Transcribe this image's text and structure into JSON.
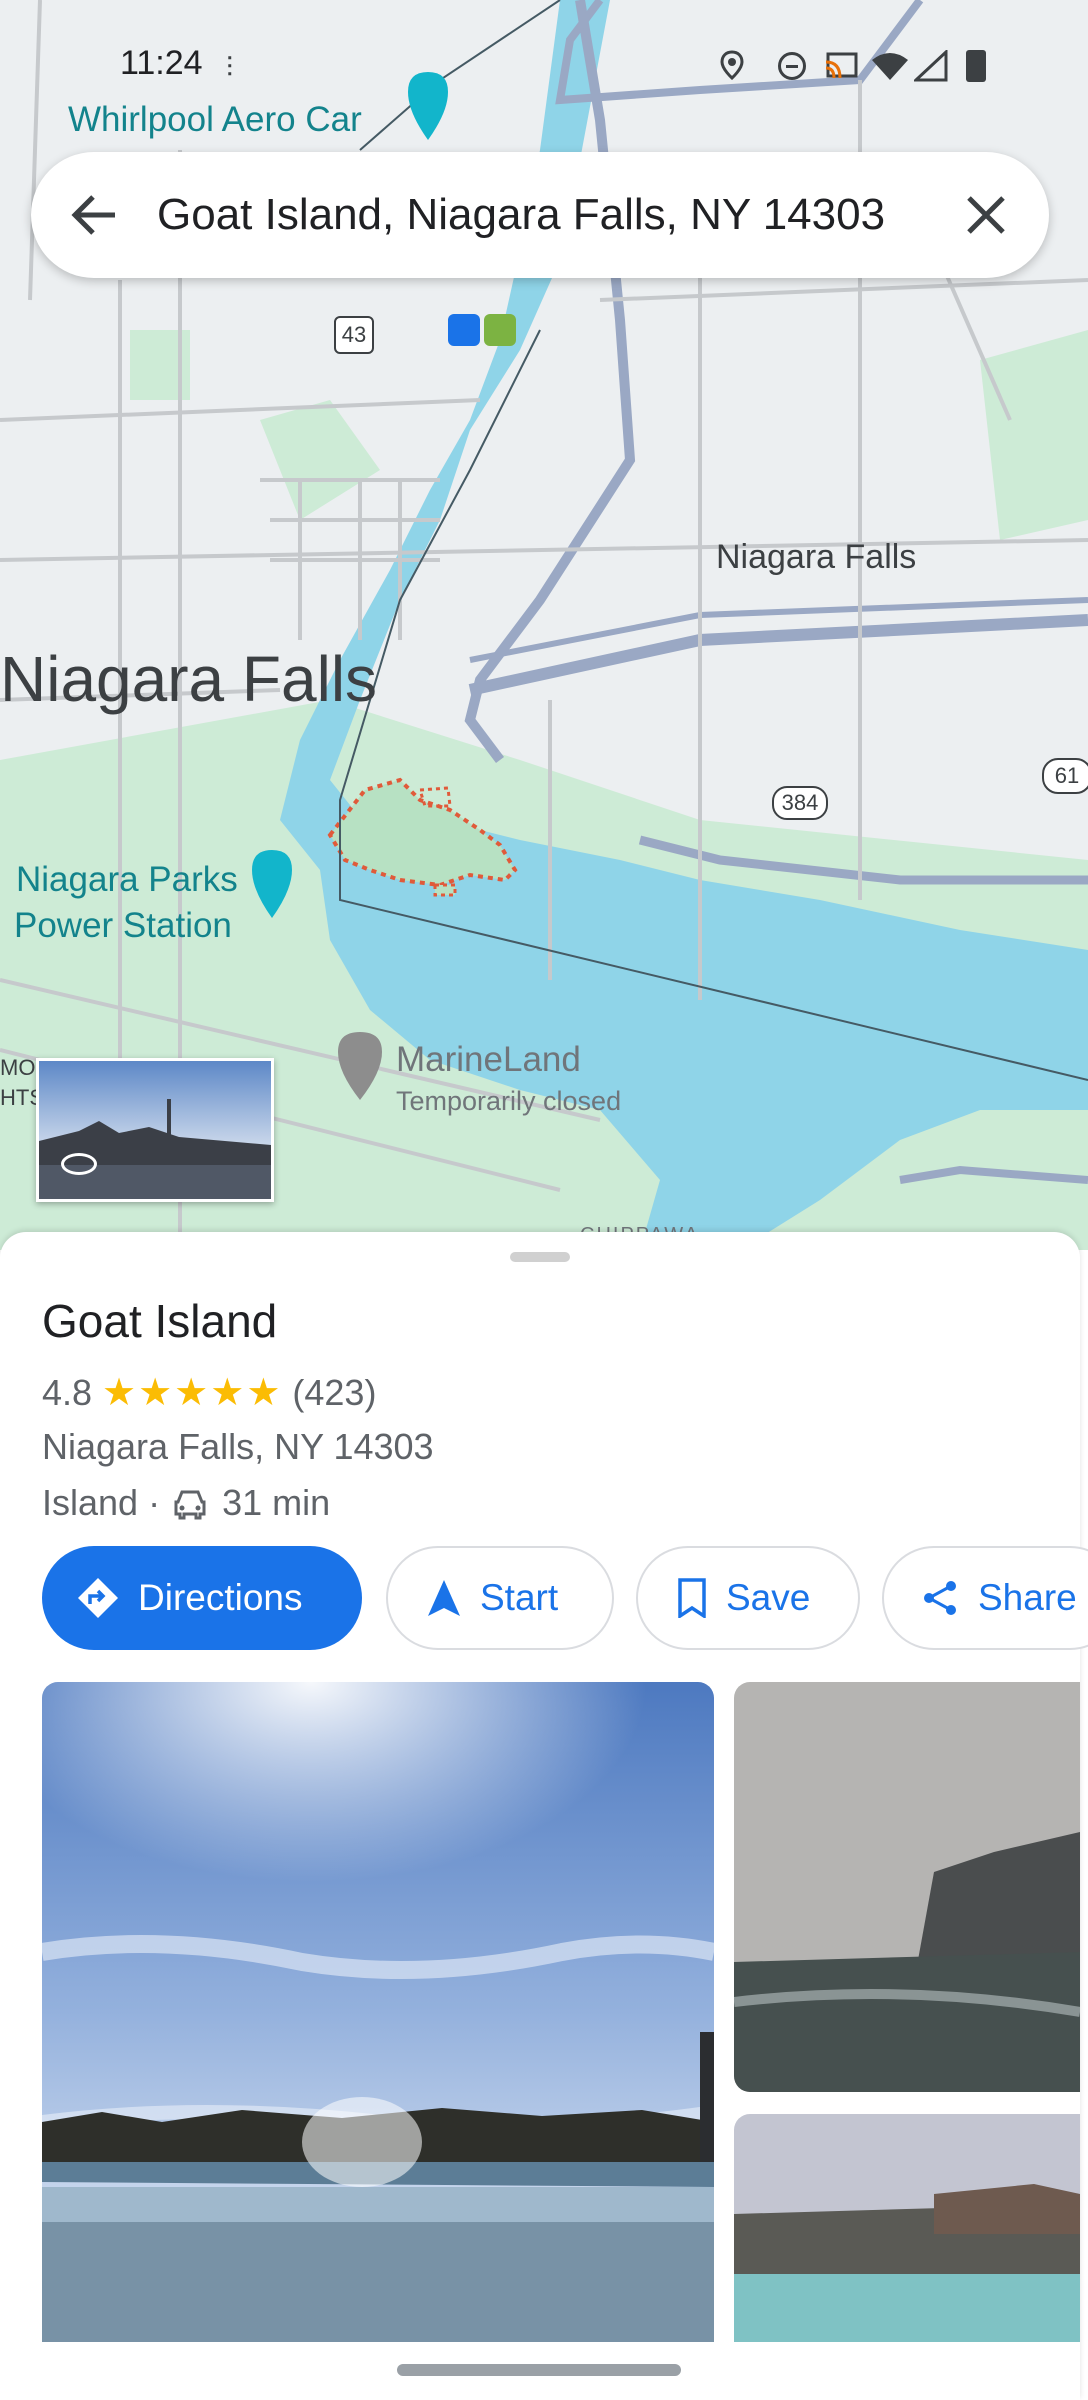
{
  "status": {
    "time": "11:24"
  },
  "search": {
    "query": "Goat Island, Niagara Falls, NY 14303"
  },
  "map": {
    "labels": {
      "whirlpool": "Whirlpool Aero Car",
      "niagara_falls_large": "Niagara Falls",
      "niagara_falls_small": "Niagara Falls",
      "parks_power_line1": "Niagara Parks",
      "parks_power_line2": "Power Station",
      "marineland": "MarineLand",
      "marineland_status": "Temporarily closed",
      "route_43": "43",
      "route_384": "384",
      "route_61": "61",
      "edge_label_1": "MON",
      "edge_label_2": "HTS",
      "chippawa": "CHIPPAWA"
    },
    "colors": {
      "water": "#8fd4e8",
      "park": "#cdebd6",
      "road": "#9aa8c4"
    }
  },
  "place": {
    "name": "Goat Island",
    "rating": "4.8",
    "stars": "★★★★★",
    "reviews": "(423)",
    "address": "Niagara Falls, NY 14303",
    "category": "Island ·",
    "drive_time": "31 min"
  },
  "actions": {
    "directions": "Directions",
    "start": "Start",
    "save": "Save",
    "share": "Share"
  },
  "icons": {
    "back": "back-arrow-icon",
    "clear": "close-icon",
    "car": "car-icon",
    "directions": "directions-diamond-icon",
    "start": "navigation-arrow-icon",
    "save": "bookmark-icon",
    "share": "share-icon"
  },
  "accent_color": "#1a73e8"
}
